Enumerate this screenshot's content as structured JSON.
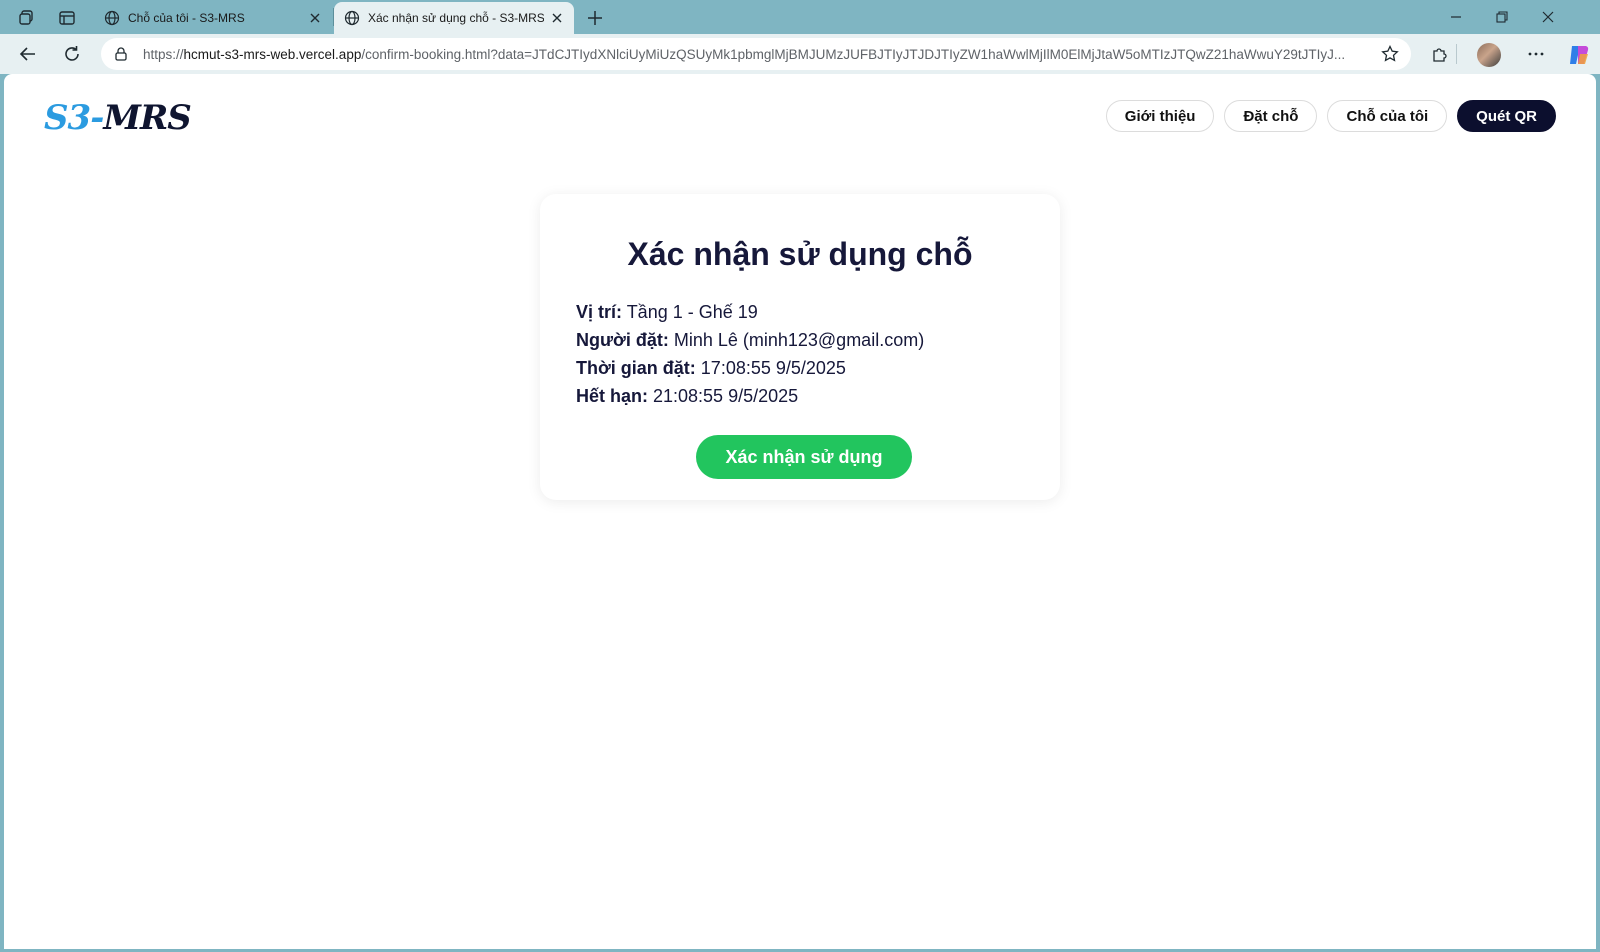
{
  "browser": {
    "tabs": [
      {
        "title": "Chỗ của tôi - S3-MRS",
        "active": false
      },
      {
        "title": "Xác nhận sử dụng chỗ - S3-MRS",
        "active": true
      }
    ],
    "url_host": "hcmut-s3-mrs-web.vercel.app",
    "url_prefix": "https://",
    "url_path": "/confirm-booking.html?data=JTdCJTIydXNlciUyMiUzQSUyMk1pbmglMjBMJUMzJUFBJTIyJTJDJTIyZW1haWwlMjIlM0ElMjJtaW5oMTIzJTQwZ21haWwuY29tJTIyJ..."
  },
  "site": {
    "logo_part1": "S3-",
    "logo_part2": "MRS",
    "nav": {
      "intro": "Giới thiệu",
      "book": "Đặt chỗ",
      "my_spots": "Chỗ của tôi",
      "scan_qr": "Quét QR"
    }
  },
  "card": {
    "title": "Xác nhận sử dụng chỗ",
    "location_label": "Vị trí:",
    "location_value": " Tầng 1 - Ghế 19",
    "booker_label": "Người đặt:",
    "booker_value": " Minh Lê (minh123@gmail.com)",
    "booked_time_label": "Thời gian đặt:",
    "booked_time_value": " 17:08:55 9/5/2025",
    "expiry_label": "Hết hạn:",
    "expiry_value": " 21:08:55 9/5/2025",
    "confirm_button": "Xác nhận sử dụng"
  },
  "colors": {
    "accent_green": "#22c55e",
    "nav_dark": "#0c0f2e",
    "logo_blue": "#2b9be0"
  }
}
